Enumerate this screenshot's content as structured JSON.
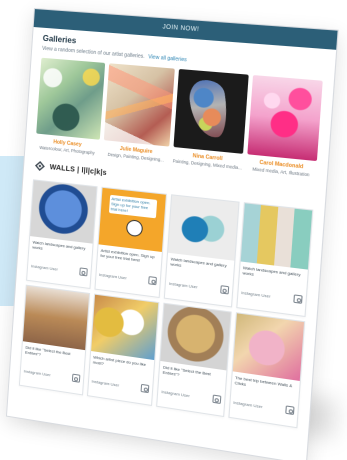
{
  "topbar": {
    "label": "JOIN NOW!"
  },
  "galleries": {
    "title": "Galleries",
    "subtitle": "View a random selection of our artist galleries.",
    "link": "View all galleries",
    "items": [
      {
        "name": "Holly Casey",
        "meta": "Watercolour, Art, Photography"
      },
      {
        "name": "Julie Maguire",
        "meta": "Design, Painting, Designing..."
      },
      {
        "name": "Nina Carroll",
        "meta": "Painting, Designing, Mixed media..."
      },
      {
        "name": "Carol Macdonald",
        "meta": "Mixed media, Art, Illustration"
      }
    ]
  },
  "brand": {
    "text": "WALLS | l|l|c|k|s",
    "icon": "brand-icon"
  },
  "feed": {
    "posts": [
      {
        "text": "Watch landscapes and gallery works",
        "footer": "Instagram User"
      },
      {
        "text": "Artist exhibition open. Sign up for your free trial here!",
        "footer": "Instagram User"
      },
      {
        "text": "Watch landscapes and gallery works",
        "footer": "Instagram User"
      },
      {
        "text": "Watch landscapes and gallery works",
        "footer": "Instagram User"
      },
      {
        "text": "Did it like \"Select the Best Entries\"?",
        "footer": "Instagram User"
      },
      {
        "text": "Which artist piece do you like most?",
        "footer": "Instagram User"
      },
      {
        "text": "Did it like \"Select the Best Entries\"?",
        "footer": "Instagram User"
      },
      {
        "text": "The best trip between Walls & Clicks",
        "footer": "Instagram User"
      }
    ]
  }
}
